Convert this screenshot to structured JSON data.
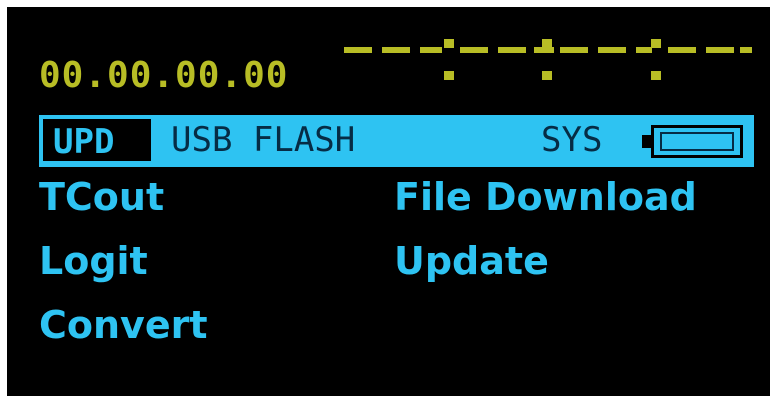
{
  "display": {
    "timecode": "00.00.00.00",
    "status_indicator": "dashed-status-indicator"
  },
  "header": {
    "mode_label": "UPD",
    "device_label": "USB FLASH",
    "system_label": "SYS",
    "battery_icon": "battery-icon"
  },
  "menu": {
    "left": [
      "TCout",
      "Logit",
      "Convert"
    ],
    "right": [
      "File Download",
      "Update"
    ]
  },
  "colors": {
    "background": "#000000",
    "timecode": "#b8bd25",
    "accent": "#2ec3f2",
    "header_text": "#062c45"
  }
}
